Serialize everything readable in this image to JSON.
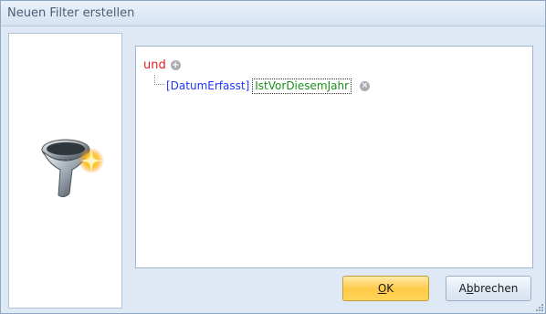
{
  "window": {
    "title": "Neuen Filter erstellen"
  },
  "filter": {
    "root_operator": "und",
    "add_icon": "plus-circle-icon",
    "conditions": [
      {
        "field": "[DatumErfasst]",
        "operator": "IstVorDiesemJahr",
        "remove_icon": "remove-circle-icon"
      }
    ]
  },
  "buttons": {
    "ok": {
      "pre": "",
      "mnemonic": "O",
      "post": "K"
    },
    "cancel": {
      "pre": "A",
      "mnemonic": "b",
      "post": "brechen"
    }
  },
  "colors": {
    "operator_red": "#e0201e",
    "field_blue": "#1f33ff",
    "condition_green": "#1c8f1c",
    "ok_button": "#ffc945"
  }
}
